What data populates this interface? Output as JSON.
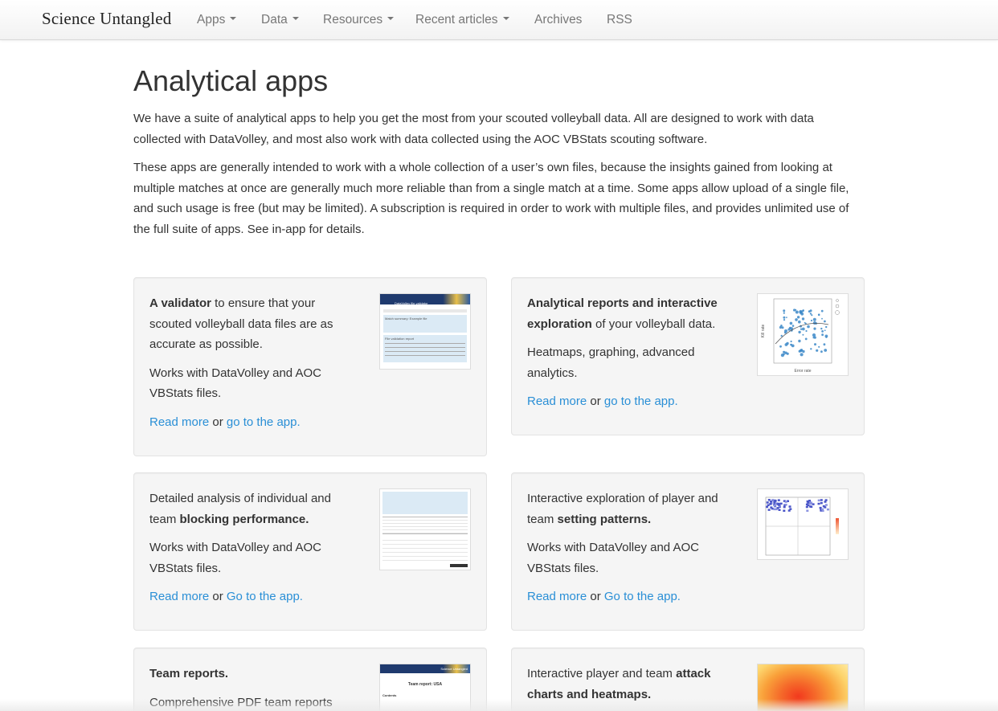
{
  "nav": {
    "brand": "Science Untangled",
    "items": [
      {
        "label": "Apps",
        "dropdown": true
      },
      {
        "label": "Data",
        "dropdown": true
      },
      {
        "label": "Resources",
        "dropdown": true
      },
      {
        "label": "Recent articles",
        "dropdown": true
      },
      {
        "label": "Archives",
        "dropdown": false
      },
      {
        "label": "RSS",
        "dropdown": false
      }
    ]
  },
  "page": {
    "title": "Analytical apps",
    "intro1": "We have a suite of analytical apps to help you get the most from your scouted volleyball data. All are designed to work with data collected with DataVolley, and most also work with data collected using the AOC VBStats scouting software.",
    "intro2": "These apps are generally intended to work with a whole collection of a user’s own files, because the insights gained from looking at multiple matches at once are generally much more reliable than from a single match at a time. Some apps allow upload of a single file, and such usage is free (but may be limited). A subscription is required in order to work with multiple files, and provides unlimited use of the full suite of apps. See in-app for details."
  },
  "cards": {
    "validator": {
      "bold": "A validator",
      "desc": " to ensure that your scouted volleyball data files are as accurate as possible.",
      "works": "Works with DataVolley and AOC VBStats files.",
      "read_more": "Read more",
      "or": " or ",
      "app_link": "go to the app.",
      "thumb_title": "DataVolley file validator",
      "thumb_sub": "Match summary: Example file",
      "thumb_sub2": "File validation report"
    },
    "reports": {
      "bold": "Analytical reports and interactive exploration",
      "desc": " of your volleyball data.",
      "works": "Heatmaps, graphing, advanced analytics.",
      "read_more": "Read more",
      "or": " or ",
      "app_link": "go to the app.",
      "thumb_xlabel": "Error rate",
      "thumb_ylabel": "Kill rate"
    },
    "blocking": {
      "pre": "Detailed analysis of individual and team ",
      "bold": "blocking performance.",
      "works": "Works with DataVolley and AOC VBStats files.",
      "read_more": "Read more",
      "or": " or ",
      "app_link": "Go to the app."
    },
    "setting": {
      "pre": "Interactive exploration of player and team ",
      "bold": "setting patterns.",
      "works": "Works with DataVolley and AOC VBStats files.",
      "read_more": "Read more",
      "or": " or ",
      "app_link": "Go to the app."
    },
    "team": {
      "bold": "Team reports.",
      "desc": "Comprehensive PDF team reports",
      "thumb_brand": "Science Untangled",
      "thumb_title": "Team report: USA",
      "thumb_label": "Contents"
    },
    "attack": {
      "pre": "Interactive player and team ",
      "bold": "attack charts and heatmaps."
    }
  }
}
